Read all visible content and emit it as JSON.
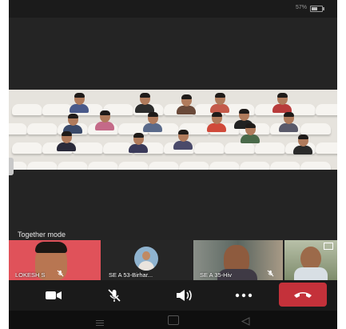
{
  "status_bar": {
    "battery_text": "57%",
    "battery_level": 0.57
  },
  "meeting": {
    "mode_label": "Together mode"
  },
  "participants": [
    {
      "name": "LOKESH S",
      "mic_icon": "microphone-muted-icon"
    },
    {
      "name": "SE A 53-Birhar..."
    },
    {
      "name": "SE A 35-Hiv",
      "mic_icon": "microphone-muted-icon"
    },
    {
      "name": ""
    }
  ],
  "controls": {
    "camera_icon": "video-camera-icon",
    "mic_icon": "microphone-muted-icon",
    "speaker_icon": "speaker-icon",
    "more_icon": "more-options-icon",
    "hangup_icon": "hang-up-phone-icon",
    "hangup_color": "#c4313a"
  },
  "nav": {
    "menu_icon": "menu-lines-icon",
    "home_icon": "home-square-icon",
    "back_icon": "back-triangle-icon"
  }
}
